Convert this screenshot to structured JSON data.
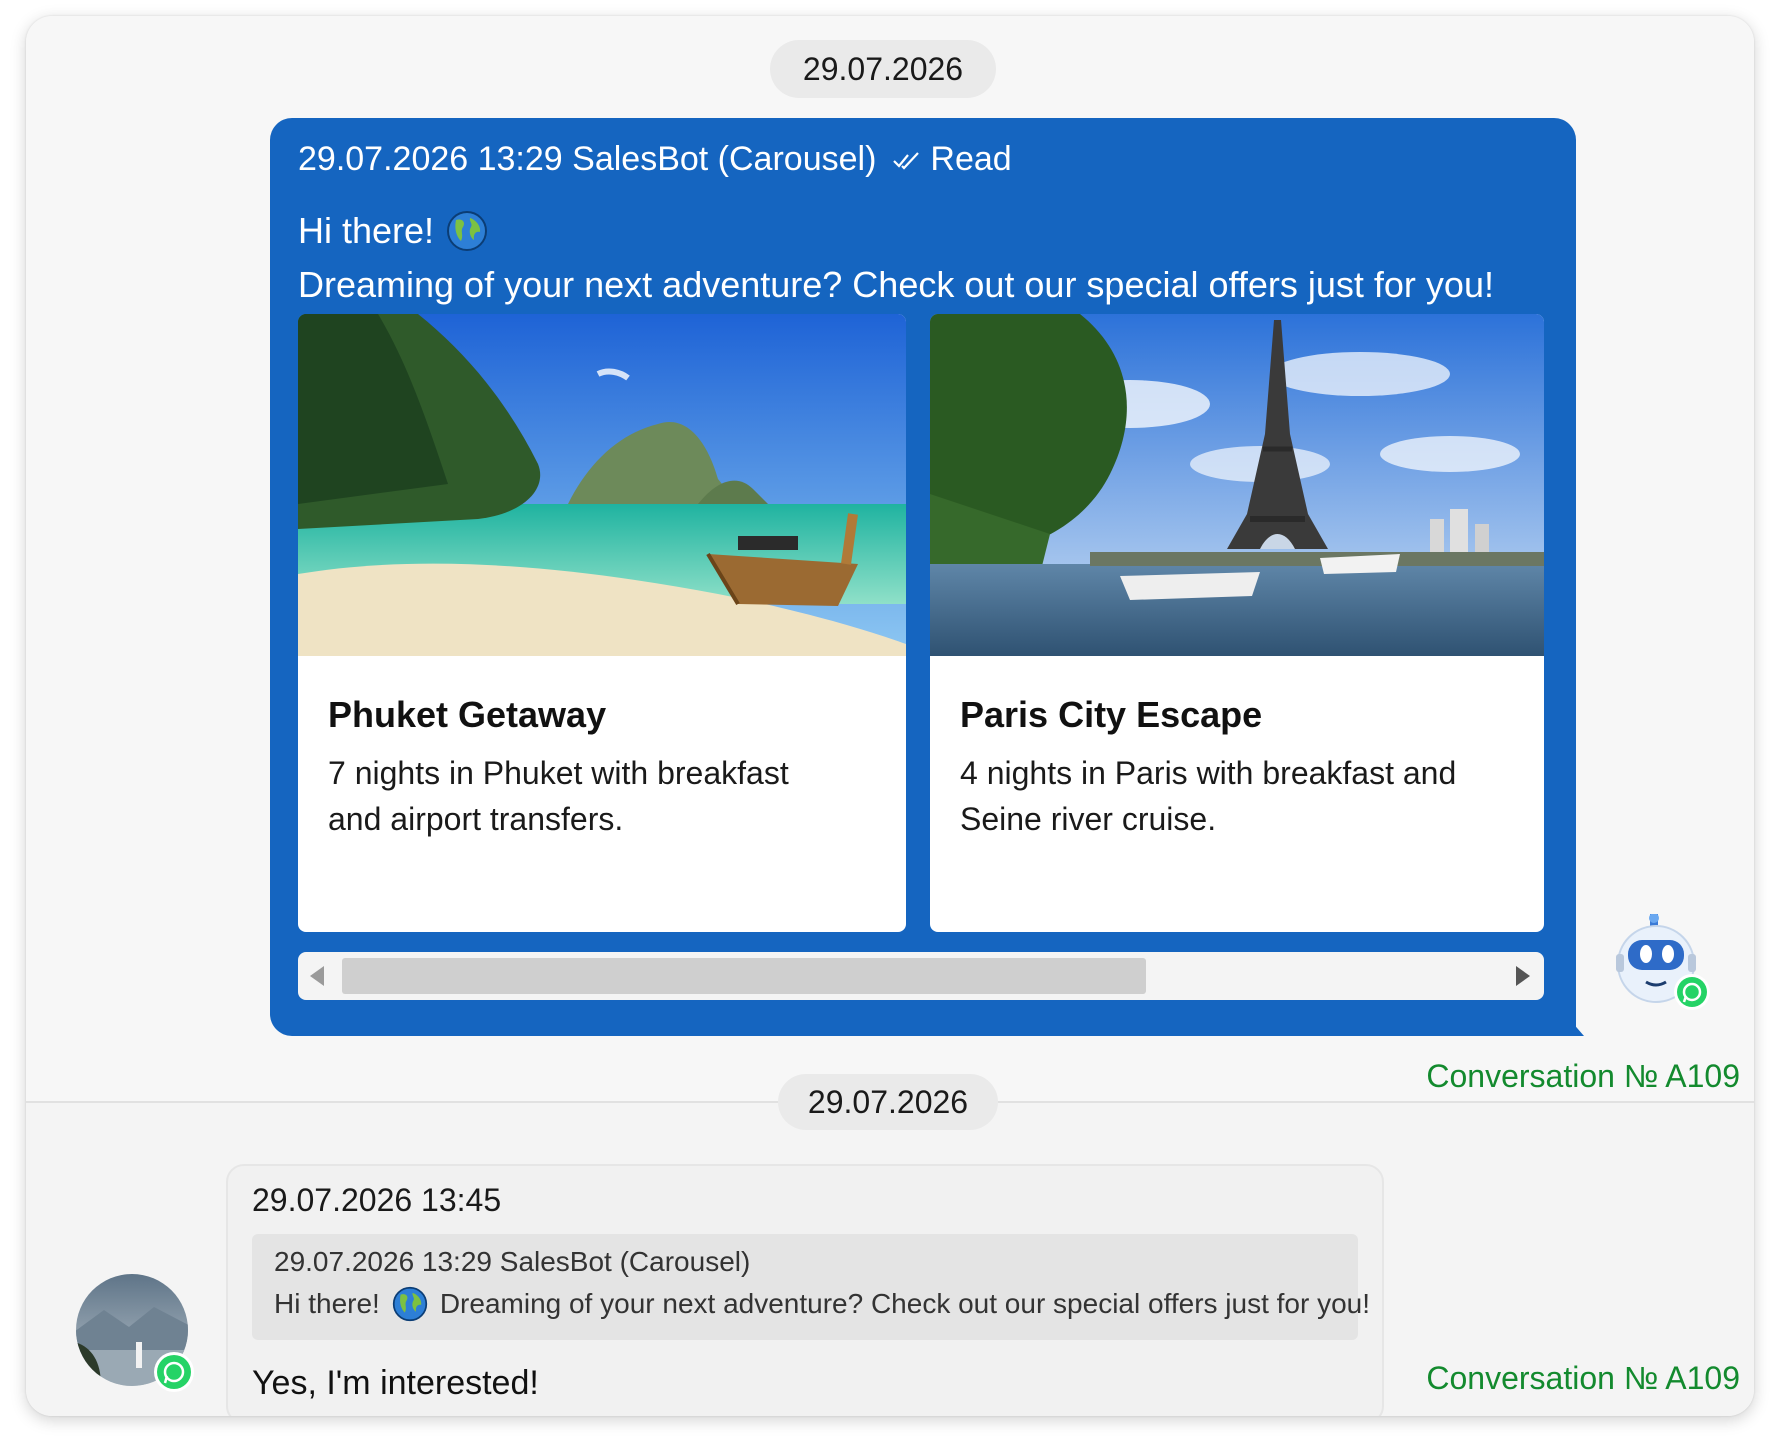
{
  "date_separators": {
    "top": "29.07.2026",
    "middle": "29.07.2026"
  },
  "bot_message": {
    "timestamp": "29.07.2026 13:29",
    "sender": "SalesBot (Carousel)",
    "status": "Read",
    "line1": "Hi there!",
    "line2": "Dreaming of your next adventure? Check out our special offers just for you!",
    "icons": {
      "status": "double-check-icon",
      "emoji": "globe-emoji-icon",
      "avatar": "robot-avatar",
      "channel": "whatsapp-icon"
    },
    "cards": [
      {
        "title": "Phuket Getaway",
        "description": "7 nights in Phuket with breakfast and airport transfers."
      },
      {
        "title": "Paris City Escape",
        "description": "4 nights in Paris with breakfast and Seine river cruise."
      }
    ],
    "carousel_scroll_fraction": 0.62
  },
  "conversation_labels": {
    "top": "Conversation № A109",
    "bottom": "Conversation № A109"
  },
  "user_message": {
    "timestamp": "29.07.2026 13:45",
    "quoted": {
      "header": "29.07.2026 13:29 SalesBot (Carousel)",
      "part1": "Hi there!",
      "part2": "Dreaming of your next adventure? Check out our special offers just for you!"
    },
    "reply": "Yes, I'm interested!"
  },
  "colors": {
    "bot_bubble": "#1565c0",
    "conversation_label": "#138a2e",
    "whatsapp": "#25d366"
  }
}
